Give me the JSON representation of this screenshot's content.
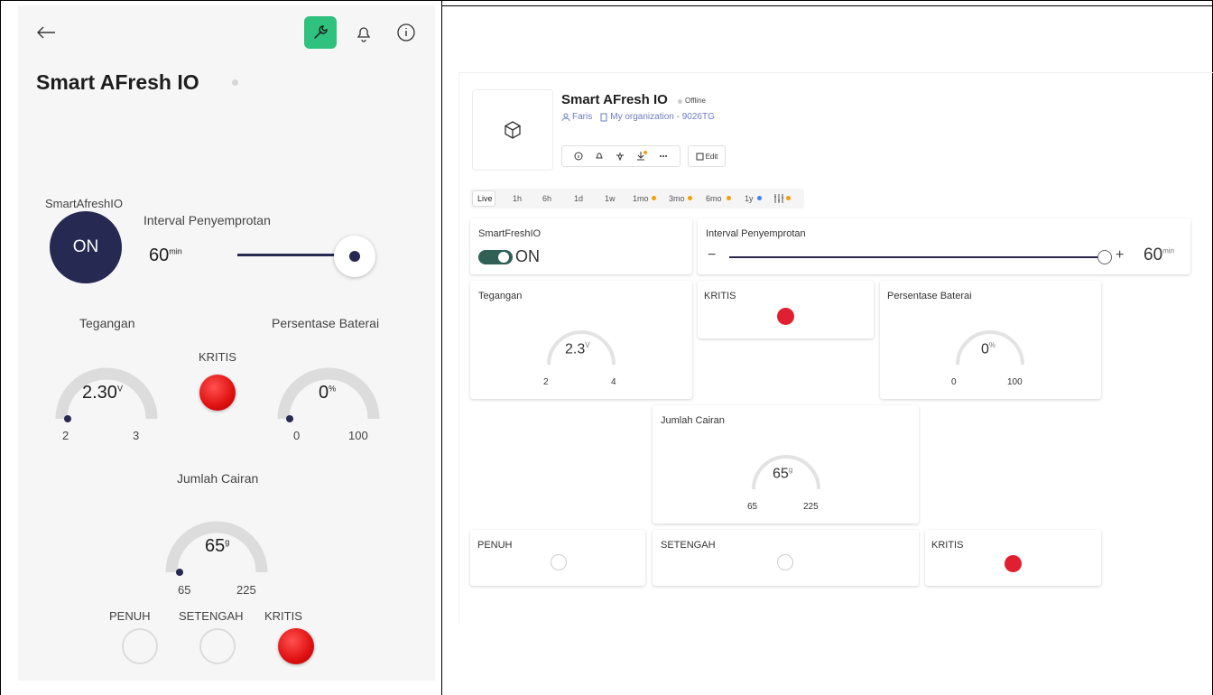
{
  "mobile": {
    "title": "Smart AFresh IO",
    "switch_label": "SmartAfreshIO",
    "switch_state": "ON",
    "interval_label": "Interval Penyemprotan",
    "interval_value": "60",
    "interval_unit": "min",
    "interval_fraction": 1.0,
    "tegangan": {
      "label": "Tegangan",
      "value": "2.30",
      "unit": "V",
      "min": "2",
      "max": "3"
    },
    "kritis_label": "KRITIS",
    "baterai": {
      "label": "Persentase Baterai",
      "value": "0",
      "unit": "%",
      "min": "0",
      "max": "100"
    },
    "cairan": {
      "label": "Jumlah Cairan",
      "value": "65",
      "unit": "g",
      "min": "65",
      "max": "225"
    },
    "indicators": [
      "PENUH",
      "SETENGAH",
      "KRITIS"
    ],
    "colors": {
      "on_button": "#262a52",
      "accent_green": "#2ec27e",
      "led_red": "#e01010"
    }
  },
  "web": {
    "device_name": "Smart AFresh IO",
    "status": "Offline",
    "owner": "Faris",
    "organization": "My organization - 9026TG",
    "edit_label": "Edit",
    "time_ranges": [
      "Live",
      "1h",
      "6h",
      "1d",
      "1w",
      "1mo",
      "3mo",
      "6mo",
      "1y"
    ],
    "switch_label": "SmartFreshIO",
    "switch_state": "ON",
    "interval_label": "Interval Penyemprotan",
    "interval_value": "60",
    "interval_unit": "min",
    "interval_minus": "−",
    "interval_plus": "+",
    "interval_fraction": 1.0,
    "tegangan": {
      "label": "Tegangan",
      "value": "2.3",
      "unit": "V",
      "min": "2",
      "max": "4"
    },
    "kritis_label": "KRITIS",
    "baterai": {
      "label": "Persentase Baterai",
      "value": "0",
      "unit": "%",
      "min": "0",
      "max": "100"
    },
    "cairan": {
      "label": "Jumlah Cairan",
      "value": "65",
      "unit": "g",
      "min": "65",
      "max": "225"
    },
    "indicators": [
      "PENUH",
      "SETENGAH",
      "KRITIS"
    ],
    "colors": {
      "toggle": "#2f5f55",
      "led_red": "#e02030",
      "dot_orange": "#f59e0b",
      "dot_blue": "#3b82f6"
    }
  }
}
